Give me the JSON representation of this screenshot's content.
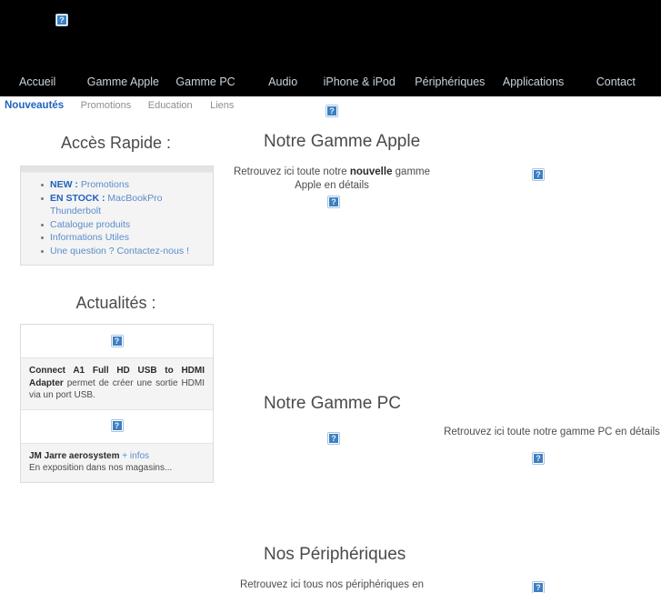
{
  "header": {
    "logo_icon": "broken-image-placeholder",
    "background_color": "#000000"
  },
  "main_nav": {
    "items": [
      {
        "label": "Accueil"
      },
      {
        "label": "Gamme Apple"
      },
      {
        "label": "Gamme PC"
      },
      {
        "label": "Audio"
      },
      {
        "label": "iPhone & iPod"
      },
      {
        "label": "Périphériques"
      },
      {
        "label": "Applications"
      },
      {
        "label": "Contact"
      }
    ]
  },
  "sub_nav": {
    "items": [
      {
        "label": "Nouveautés",
        "active": true
      },
      {
        "label": "Promotions",
        "active": false
      },
      {
        "label": "Education",
        "active": false
      },
      {
        "label": "Liens",
        "active": false
      }
    ],
    "active_color": "#2063bf"
  },
  "sidebar": {
    "quick_access": {
      "title": "Accès Rapide :",
      "items": [
        {
          "strong": "NEW :",
          "text": " Promotions"
        },
        {
          "strong": "EN STOCK :",
          "text": " MacBookPro Thunderbolt"
        },
        {
          "strong": "",
          "text": "Catalogue produits"
        },
        {
          "strong": "",
          "text": "Informations Utiles"
        },
        {
          "strong": "",
          "text": "Une question ? Contactez-nous !"
        }
      ]
    },
    "news": {
      "title": "Actualités :",
      "entries": [
        {
          "image_icon": "broken-image-placeholder",
          "headline": "Connect A1 Full HD USB to HDMI Adapter",
          "body": " permet de créer une sortie HDMI via un port USB.",
          "infos_link": ""
        },
        {
          "image_icon": "broken-image-placeholder",
          "headline": "JM Jarre aerosystem",
          "infos_link": "+ infos",
          "body": "En exposition dans nos magasins..."
        }
      ]
    }
  },
  "main": {
    "sections": [
      {
        "title": "Notre Gamme Apple",
        "lede_prefix": "Retrouvez ici toute notre ",
        "lede_strong": "nouvelle",
        "lede_suffix": " gamme Apple en détails",
        "image_icon": "broken-image-placeholder"
      },
      {
        "title": "Notre Gamme PC",
        "lede_prefix": "Retrouvez ici toute notre gamme PC en détails",
        "lede_strong": "",
        "lede_suffix": "",
        "image_icon": "broken-image-placeholder"
      },
      {
        "title": "Nos Périphériques",
        "lede_prefix": "Retrouvez ici tous nos périphériques en",
        "lede_strong": "",
        "lede_suffix": "",
        "image_icon": "broken-image-placeholder"
      }
    ]
  }
}
